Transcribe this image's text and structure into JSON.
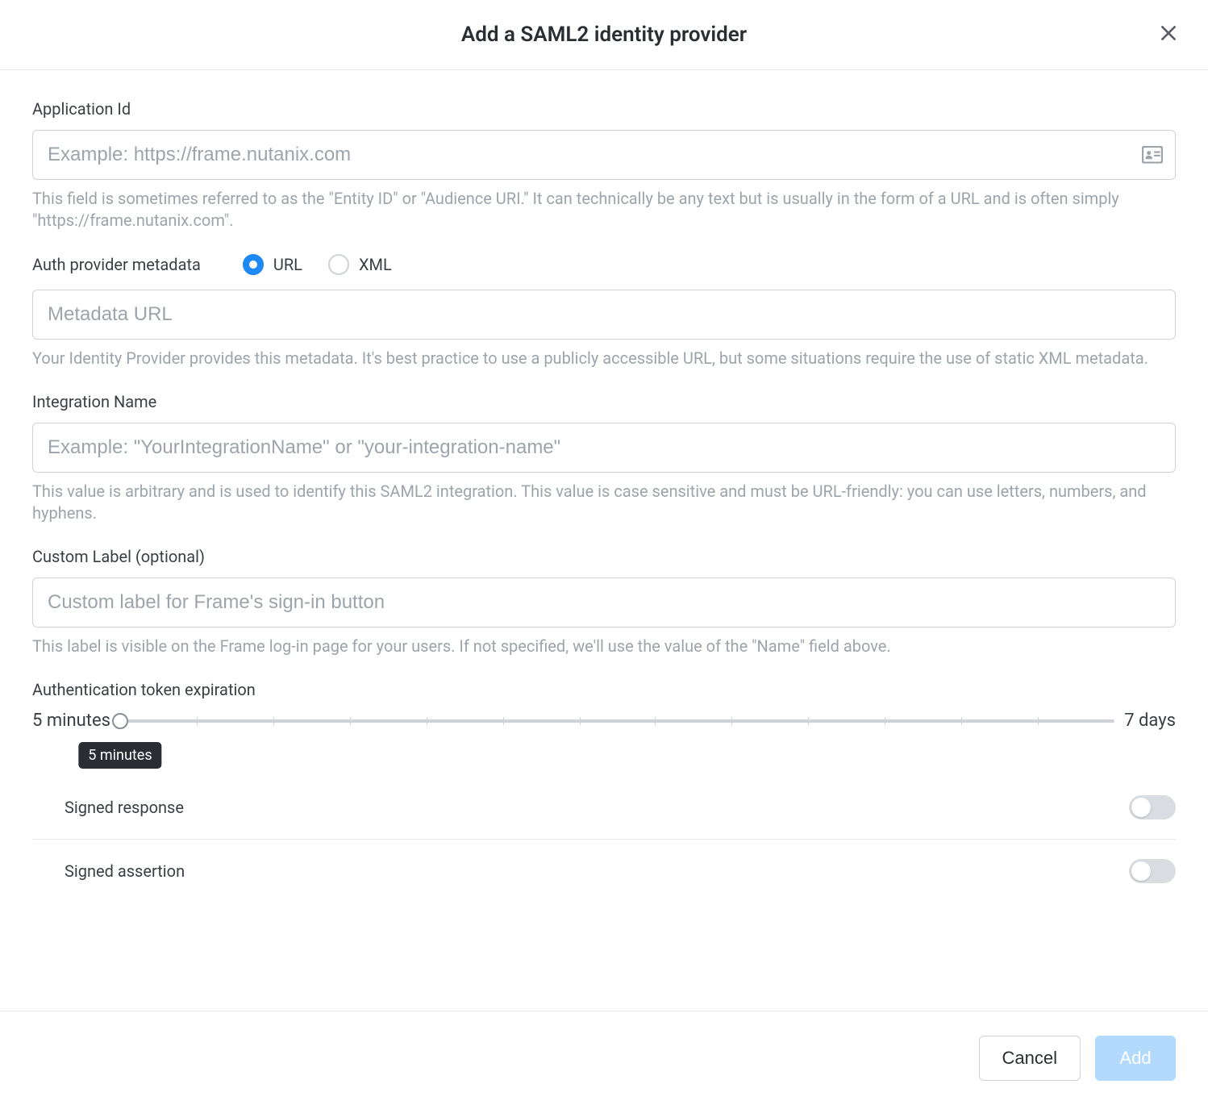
{
  "header": {
    "title": "Add a SAML2 identity provider"
  },
  "application_id": {
    "label": "Application Id",
    "placeholder": "Example: https://frame.nutanix.com",
    "hint": "This field is sometimes referred to as the \"Entity ID\" or \"Audience URI.\" It can technically be any text but is usually in the form of a URL and is often simply \"https://frame.nutanix.com\"."
  },
  "auth_provider": {
    "label": "Auth provider metadata",
    "options": {
      "url": "URL",
      "xml": "XML"
    },
    "selected": "url",
    "metadata_placeholder": "Metadata URL",
    "hint": "Your Identity Provider provides this metadata. It's best practice to use a publicly accessible URL, but some situations require the use of static XML metadata."
  },
  "integration_name": {
    "label": "Integration Name",
    "placeholder": "Example: \"YourIntegrationName\" or \"your-integration-name\"",
    "hint": "This value is arbitrary and is used to identify this SAML2 integration. This value is case sensitive and must be URL-friendly: you can use letters, numbers, and hyphens."
  },
  "custom_label": {
    "label": "Custom Label (optional)",
    "placeholder": "Custom label for Frame's sign-in button",
    "hint": "This label is visible on the Frame log-in page for your users. If not specified, we'll use the value of the \"Name\" field above."
  },
  "token_expiration": {
    "label": "Authentication token expiration",
    "min_label": "5 minutes",
    "max_label": "7 days",
    "current_tooltip": "5 minutes"
  },
  "toggles": {
    "signed_response": {
      "label": "Signed response",
      "on": false
    },
    "signed_assertion": {
      "label": "Signed assertion",
      "on": false
    }
  },
  "footer": {
    "cancel": "Cancel",
    "add": "Add"
  }
}
